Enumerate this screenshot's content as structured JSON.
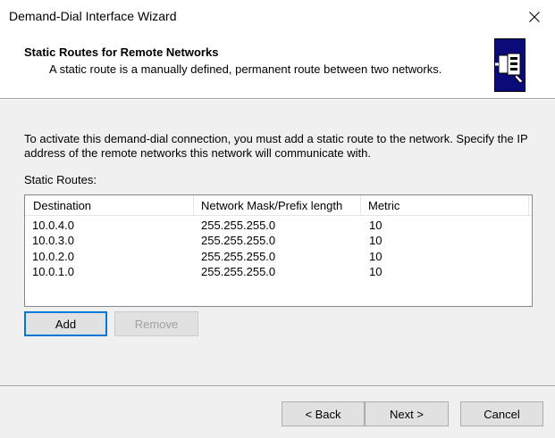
{
  "window": {
    "title": "Demand-Dial Interface Wizard",
    "close_glyph": "✕"
  },
  "header": {
    "title": "Static Routes for Remote Networks",
    "subtitle": "A static route is a manually defined, permanent route between two networks.",
    "icon": "network-cable-icon"
  },
  "main": {
    "description": "To activate this demand-dial connection, you must add a static route to the network. Specify the IP address of the remote networks this network will communicate with.",
    "routes_label": "Static Routes:",
    "columns": [
      "Destination",
      "Network Mask/Prefix length",
      "Metric"
    ],
    "rows": [
      [
        "10.0.4.0",
        "255.255.255.0",
        "10"
      ],
      [
        "10.0.3.0",
        "255.255.255.0",
        "10"
      ],
      [
        "10.0.2.0",
        "255.255.255.0",
        "10"
      ],
      [
        "10.0.1.0",
        "255.255.255.0",
        "10"
      ]
    ],
    "add_label": "Add",
    "remove_label": "Remove"
  },
  "footer": {
    "back_label": "< Back",
    "next_label": "Next >",
    "cancel_label": "Cancel"
  },
  "colors": {
    "accent": "#0078d7",
    "icon_background": "#0a0a78"
  }
}
